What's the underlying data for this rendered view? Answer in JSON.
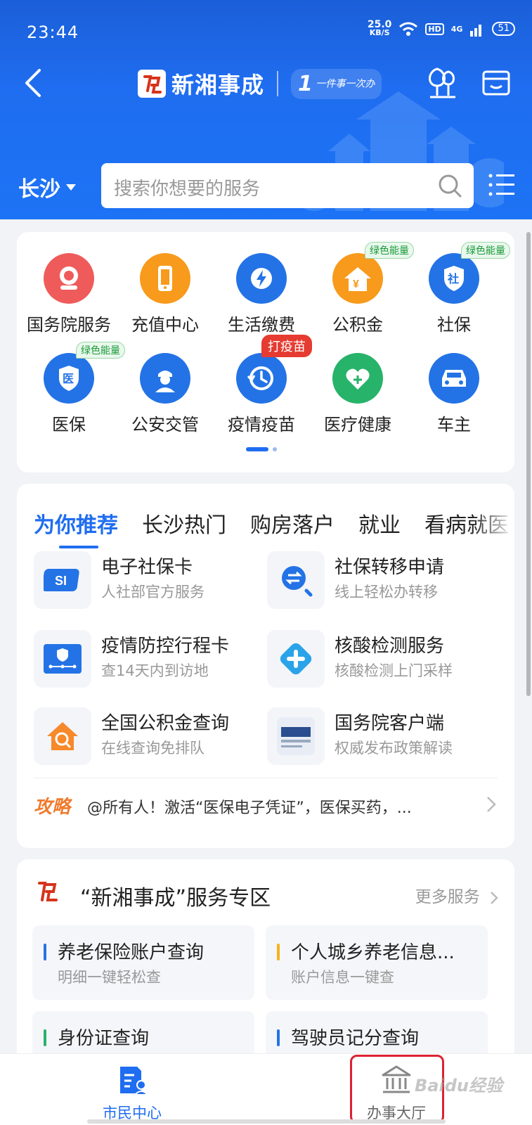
{
  "status_bar": {
    "time": "23:44",
    "net_speed_value": "25.0",
    "net_speed_unit": "KB/S",
    "hd_badge": "HD",
    "signal_label": "4G",
    "battery": "51"
  },
  "header": {
    "logo_badge": "rightly",
    "logo_text": "新湘事成",
    "slogan_number": "1",
    "slogan_text": "一件事一次办",
    "city": "长沙",
    "search_placeholder": "搜索你想要的服务"
  },
  "quick_grid": {
    "items": [
      {
        "label": "国务院服务",
        "icon": "state-council-icon",
        "color": "#ef5b5b",
        "badge": ""
      },
      {
        "label": "充值中心",
        "icon": "phone-icon",
        "color": "#f89a1c",
        "badge": ""
      },
      {
        "label": "生活缴费",
        "icon": "utility-bolt-icon",
        "color": "#2473e6",
        "badge": ""
      },
      {
        "label": "公积金",
        "icon": "house-fund-icon",
        "color": "#f89a1c",
        "badge": "绿色能量"
      },
      {
        "label": "社保",
        "icon": "social-security-shield-icon",
        "color": "#2473e6",
        "badge": "绿色能量"
      },
      {
        "label": "医保",
        "icon": "medical-insurance-shield-icon",
        "color": "#2473e6",
        "badge": "绿色能量"
      },
      {
        "label": "公安交管",
        "icon": "police-icon",
        "color": "#2473e6",
        "badge": ""
      },
      {
        "label": "疫情疫苗",
        "icon": "epidemic-clock-icon",
        "color": "#2473e6",
        "badge": "打疫苗"
      },
      {
        "label": "医疗健康",
        "icon": "health-heart-icon",
        "color": "#27b36a",
        "badge": ""
      },
      {
        "label": "车主",
        "icon": "car-icon",
        "color": "#2473e6",
        "badge": ""
      }
    ]
  },
  "recommend": {
    "tabs": [
      "为你推荐",
      "长沙热门",
      "购房落户",
      "就业",
      "看病就医"
    ],
    "services": [
      {
        "title": "电子社保卡",
        "subtitle": "人社部官方服务"
      },
      {
        "title": "社保转移申请",
        "subtitle": "线上轻松办转移"
      },
      {
        "title": "疫情防控行程卡",
        "subtitle": "查14天内到访地"
      },
      {
        "title": "核酸检测服务",
        "subtitle": "核酸检测上门采样"
      },
      {
        "title": "全国公积金查询",
        "subtitle": "在线查询免排队"
      },
      {
        "title": "国务院客户端",
        "subtitle": "权威发布政策解读"
      }
    ],
    "tips_tag": "攻略",
    "tips_text": "@所有人！激活“医保电子凭证”，医保买药，..."
  },
  "zone": {
    "title": "“新湘事成”服务专区",
    "more": "更多服务",
    "items": [
      {
        "title": "养老保险账户查询",
        "subtitle": "明细一键轻松查",
        "bar_color": "#2473e6"
      },
      {
        "title": "个人城乡养老信息...",
        "subtitle": "账户信息一键查",
        "bar_color": "#f5b21c"
      },
      {
        "title": "身份证查询",
        "subtitle": "",
        "bar_color": "#27b36a"
      },
      {
        "title": "驾驶员记分查询",
        "subtitle": "",
        "bar_color": "#2473e6"
      }
    ]
  },
  "bottom_nav": {
    "citizen": "市民中心",
    "hall": "办事大厅",
    "active_color": "#1f6df0"
  },
  "watermark": "Baidu经验"
}
